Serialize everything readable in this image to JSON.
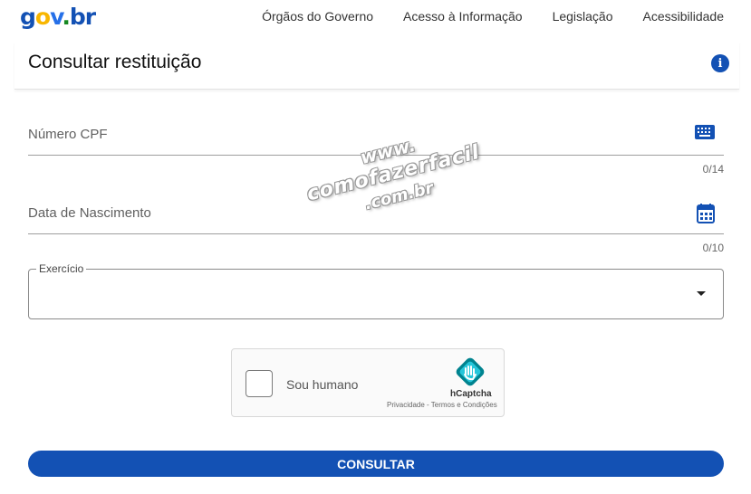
{
  "header": {
    "logo": {
      "g": "g",
      "o": "o",
      "v": "v",
      "dot": ".",
      "br": "br"
    },
    "nav": [
      "Órgãos do Governo",
      "Acesso à Informação",
      "Legislação",
      "Acessibilidade"
    ]
  },
  "page": {
    "title": "Consultar restituição"
  },
  "form": {
    "cpf": {
      "placeholder": "Número CPF",
      "value": "",
      "counter": "0/14"
    },
    "birth_date": {
      "placeholder": "Data de Nascimento",
      "value": "",
      "counter": "0/10"
    },
    "exercicio": {
      "label": "Exercício",
      "value": ""
    },
    "captcha": {
      "label": "Sou humano",
      "brand": "hCaptcha",
      "links": "Privacidade - Termos e Condições"
    },
    "submit_label": "CONSULTAR"
  },
  "watermark": {
    "line1": "www.",
    "line2": "comofazerfacil",
    "line3": ".com.br"
  },
  "colors": {
    "primary": "#1351b4",
    "gov_yellow": "#f8b600",
    "gov_green": "#168821"
  },
  "icons": {
    "info": "info-icon",
    "keyboard": "keyboard-icon",
    "calendar": "calendar-icon",
    "dropdown": "caret-down-icon",
    "hcaptcha": "hcaptcha-logo-icon"
  }
}
